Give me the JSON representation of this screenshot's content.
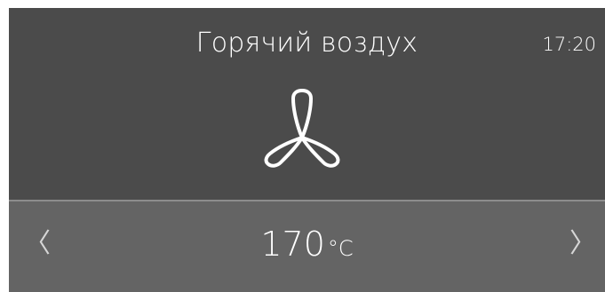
{
  "header": {
    "mode_title": "Горячий воздух",
    "time": "17:20",
    "mode_icon": "fan-icon"
  },
  "temperature": {
    "value": "170",
    "unit": "°C",
    "prev_icon": "chevron-left-icon",
    "next_icon": "chevron-right-icon",
    "prev_glyph": "〈",
    "next_glyph": "〉"
  },
  "colors": {
    "top_panel": "#4b4b4b",
    "bottom_panel": "#646464",
    "divider": "#8c8c8c",
    "text": "#ffffff"
  }
}
